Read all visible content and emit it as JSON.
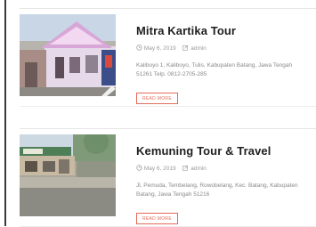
{
  "posts": [
    {
      "title": "Mitra Kartika Tour",
      "date": "May 6, 2019",
      "author": "admin",
      "excerpt_line1": "Kaliboyo 1, Kaliboyo, Tulis, Kabupaten Batang, Jawa Tengah",
      "excerpt_line2": "51261 Telp. 0812-2705-285",
      "read_more": "READ MORE"
    },
    {
      "title": "Kemuning Tour & Travel",
      "date": "May 6, 2019",
      "author": "admin",
      "excerpt_line1": "Jl. Pemuda, Tembelang, Rowobelang, Kec. Batang, Kabupaten",
      "excerpt_line2": "Batang, Jawa Tengah 51216",
      "read_more": "READ MORE"
    }
  ],
  "icons": {
    "date": "clock-icon",
    "author": "edit-icon"
  },
  "colors": {
    "accent": "#e46a5a",
    "title": "#1f1f1f",
    "meta": "#9a9a9a"
  }
}
